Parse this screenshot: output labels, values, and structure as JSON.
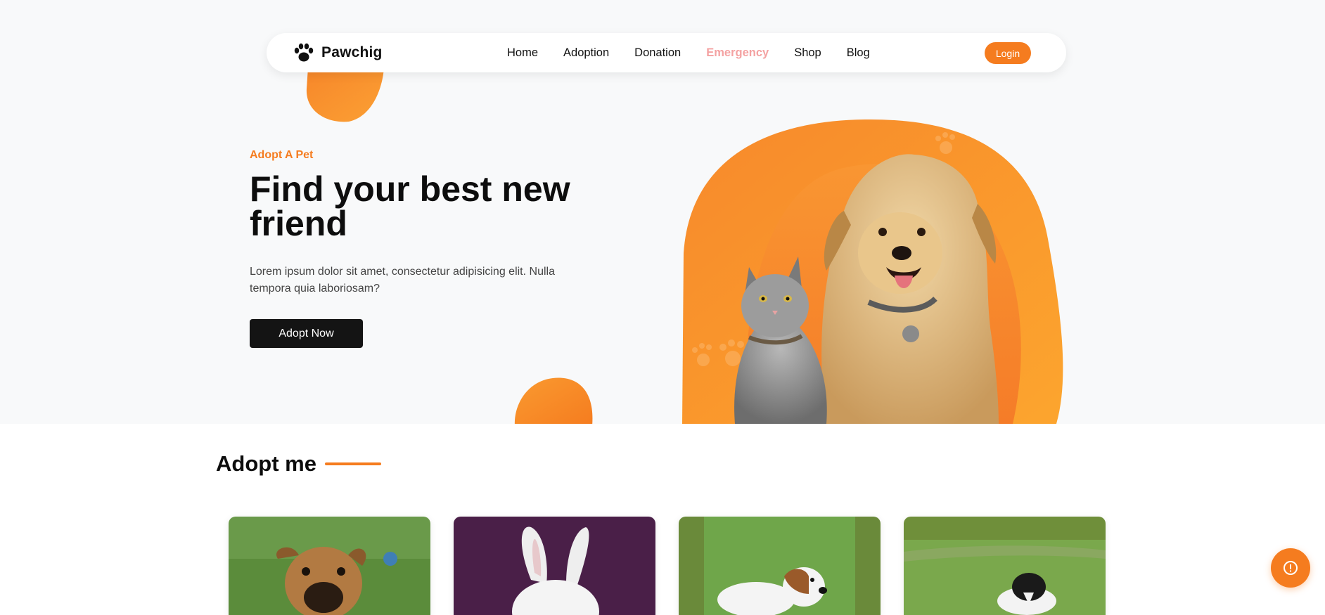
{
  "brand": {
    "name": "Pawchig",
    "icon": "paw-icon"
  },
  "nav": {
    "links": [
      {
        "label": "Home",
        "active": false
      },
      {
        "label": "Adoption",
        "active": false
      },
      {
        "label": "Donation",
        "active": false
      },
      {
        "label": "Emergency",
        "active": true
      },
      {
        "label": "Shop",
        "active": false
      },
      {
        "label": "Blog",
        "active": false
      }
    ],
    "login_label": "Login"
  },
  "hero": {
    "eyebrow": "Adopt A Pet",
    "headline": "Find your best new friend",
    "lead": "Lorem ipsum dolor sit amet, consectetur adipisicing elit. Nulla tempora quia laboriosam?",
    "cta_label": "Adopt Now"
  },
  "adopt_section": {
    "title": "Adopt me"
  },
  "cards": [
    {
      "photo": "puppy-photo"
    },
    {
      "photo": "rabbit-photo"
    },
    {
      "photo": "dog-photo"
    },
    {
      "photo": "puppy-field-photo"
    }
  ],
  "colors": {
    "accent": "#f57c1f",
    "active_nav": "#f4a2a2",
    "dark_button": "#141414",
    "hero_bg": "#f8f9fa"
  },
  "icons": {
    "help_fab": "alert-circle-icon"
  }
}
